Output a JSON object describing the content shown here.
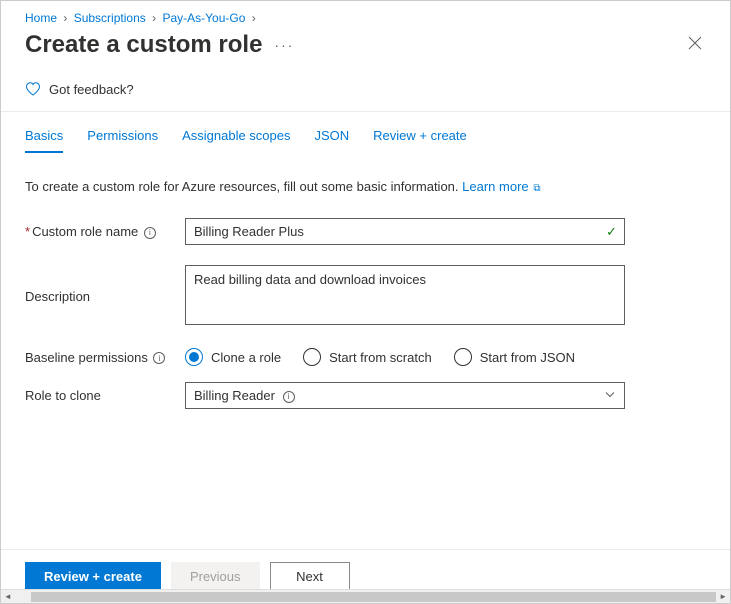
{
  "breadcrumb": {
    "items": [
      {
        "label": "Home"
      },
      {
        "label": "Subscriptions"
      },
      {
        "label": "Pay-As-You-Go"
      }
    ]
  },
  "title": "Create a custom role",
  "feedback_label": "Got feedback?",
  "tabs": [
    {
      "label": "Basics",
      "active": true
    },
    {
      "label": "Permissions",
      "active": false
    },
    {
      "label": "Assignable scopes",
      "active": false
    },
    {
      "label": "JSON",
      "active": false
    },
    {
      "label": "Review + create",
      "active": false
    }
  ],
  "intro": {
    "text": "To create a custom role for Azure resources, fill out some basic information.",
    "learn_more": "Learn more"
  },
  "form": {
    "role_name_label": "Custom role name",
    "role_name_value": "Billing Reader Plus",
    "description_label": "Description",
    "description_value": "Read billing data and download invoices",
    "baseline_label": "Baseline permissions",
    "baseline_options": [
      {
        "label": "Clone a role",
        "checked": true
      },
      {
        "label": "Start from scratch",
        "checked": false
      },
      {
        "label": "Start from JSON",
        "checked": false
      }
    ],
    "role_to_clone_label": "Role to clone",
    "role_to_clone_value": "Billing Reader"
  },
  "footer": {
    "review_create": "Review + create",
    "previous": "Previous",
    "next": "Next"
  }
}
